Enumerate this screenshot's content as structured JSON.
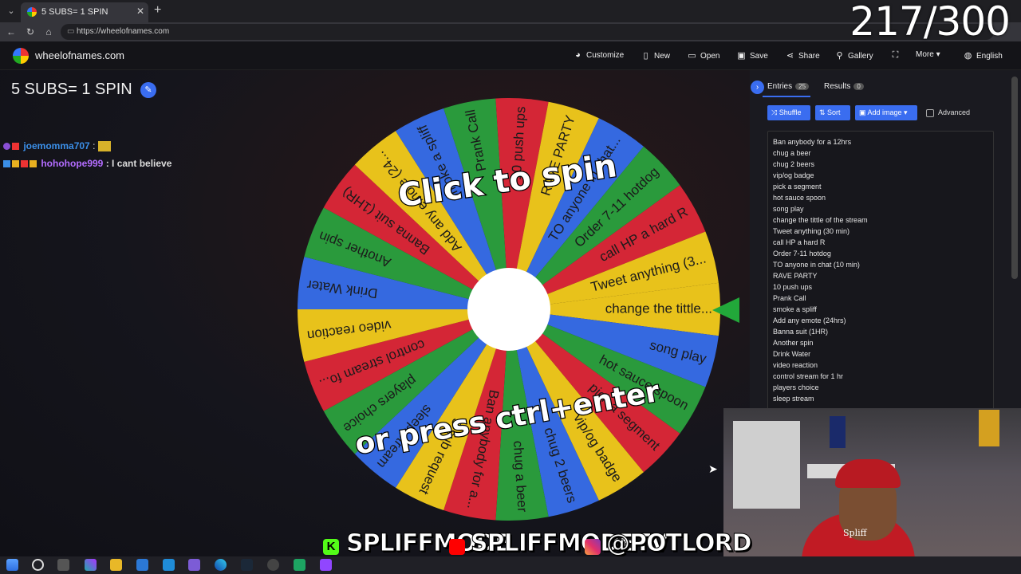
{
  "browser": {
    "tab_title": "5 SUBS= 1 SPIN",
    "url": "https://wheelofnames.com"
  },
  "overlay": {
    "counter": "217/300"
  },
  "site": {
    "name": "wheelofnames.com",
    "menu": {
      "customize": "Customize",
      "new": "New",
      "open": "Open",
      "save": "Save",
      "share": "Share",
      "gallery": "Gallery",
      "more": "More",
      "language": "English"
    }
  },
  "main": {
    "title": "5 SUBS= 1 SPIN"
  },
  "chat": [
    {
      "user": "joemomma707",
      "message": ":",
      "user_color": "#3b8fe8"
    },
    {
      "user": "hohohope999",
      "message": ": I cant believe",
      "user_color": "#b36cff"
    }
  ],
  "wheel": {
    "prompt_top": "Click to spin",
    "prompt_bottom": "or press ctrl+enter",
    "colors": [
      "#e8c21b",
      "#3569e0",
      "#2a9a3c",
      "#d42636"
    ],
    "segments": [
      "change the tittle...",
      "song play",
      "hot sauce spoon",
      "pick a segment",
      "vip/og badge",
      "chug 2 beers",
      "chug a beer",
      "Ban anybody for a...",
      "5 sub request",
      "sleep stream",
      "players choice",
      "control stream fo...",
      "video reaction",
      "Drink Water",
      "Another spin",
      "Banna suit (1HR)",
      "Add any emote (24...",
      "smoke a spliff",
      "Prank Call",
      "10 push ups",
      "RAVE PARTY",
      "TO anyone in chat...",
      "Order 7-11 hotdog",
      "call HP a hard R",
      "Tweet anything (3..."
    ]
  },
  "panel": {
    "tabs": [
      {
        "label": "Entries",
        "count": "25"
      },
      {
        "label": "Results",
        "count": "0"
      }
    ],
    "toolbar": {
      "shuffle": "Shuffle",
      "sort": "Sort",
      "add_image": "Add image",
      "advanced": "Advanced"
    },
    "entries": [
      "Ban anybody for a 12hrs",
      "chug a beer",
      "chug 2 beers",
      "vip/og badge",
      "pick a segment",
      "hot sauce spoon",
      "song play",
      "change the tittle of the stream",
      "Tweet anything (30 min)",
      "call HP a hard R",
      "Order 7-11 hotdog",
      "TO anyone in chat (10 min)",
      "RAVE PARTY",
      "10 push ups",
      "Prank Call",
      "smoke a spliff",
      "Add any emote (24hrs)",
      "Banna suit (1HR)",
      "Another spin",
      "Drink Water",
      "video reaction",
      "control stream for 1 hr",
      "players choice",
      "sleep stream"
    ]
  },
  "webcam": {
    "shirt_text": "Spliff"
  },
  "socials": {
    "kick": "SPLIFFMODE",
    "youtube": "SPLIFFMODETV",
    "instagram": "@POTLORD"
  }
}
